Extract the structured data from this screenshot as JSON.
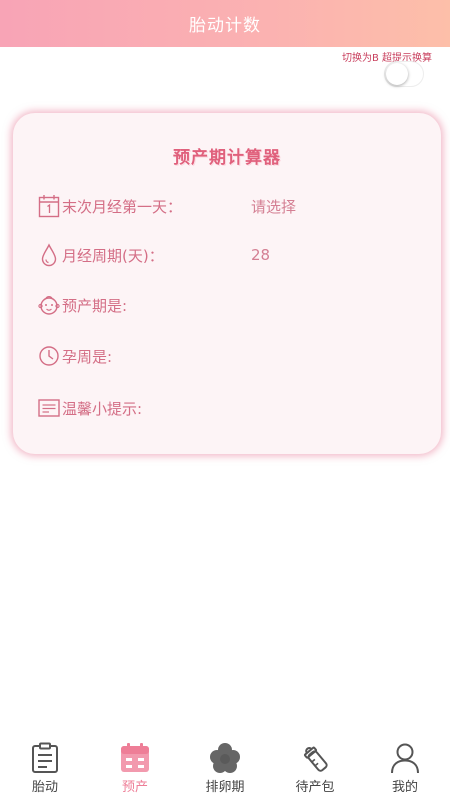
{
  "header": {
    "title": "胎动计数"
  },
  "switch": {
    "label": "切换为B 超提示换算",
    "on": false
  },
  "card": {
    "title": "预产期计算器",
    "rows": [
      {
        "icon": "calendar-icon",
        "label": "末次月经第一天：",
        "value": "请选择"
      },
      {
        "icon": "drop-icon",
        "label": "月经周期(天)：",
        "value": "28"
      },
      {
        "icon": "baby-face-icon",
        "label": "预产期是:",
        "value": ""
      },
      {
        "icon": "clock-icon",
        "label": "孕周是:",
        "value": ""
      },
      {
        "icon": "note-icon",
        "label": "温馨小提示:",
        "value": ""
      }
    ]
  },
  "tabbar": {
    "active_color": "#ee7e97",
    "items": [
      {
        "label": "胎动",
        "icon": "clipboard-icon"
      },
      {
        "label": "预产",
        "icon": "calendar-icon",
        "active": true
      },
      {
        "label": "排卵期",
        "icon": "flower-icon"
      },
      {
        "label": "待产包",
        "icon": "baby-bottle-icon"
      },
      {
        "label": "我的",
        "icon": "person-icon"
      }
    ]
  }
}
